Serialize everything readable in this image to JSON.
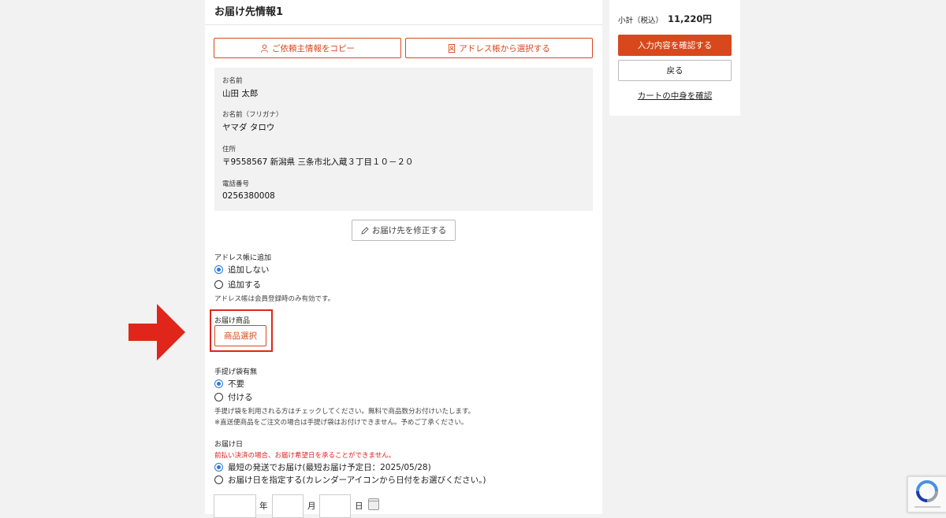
{
  "form": {
    "section_title": "お届け先情報1",
    "copy_button": "ご依頼主情報をコピー",
    "addressbook_button": "アドレス帳から選択する",
    "info": {
      "name_label": "お名前",
      "name_value": "山田 太郎",
      "kana_label": "お名前（フリガナ）",
      "kana_value": "ヤマダ タロウ",
      "address_label": "住所",
      "address_value": "〒9558567 新潟県 三条市北入蔵３丁目１０－２０",
      "phone_label": "電話番号",
      "phone_value": "0256380008"
    },
    "edit_button": "お届け先を修正する",
    "addressbook_add": {
      "label": "アドレス帳に追加",
      "options": [
        "追加しない",
        "追加する"
      ],
      "selected_index": 0,
      "note": "アドレス帳は会員登録時のみ有効です。"
    },
    "product": {
      "label": "お届け商品",
      "button": "商品選択"
    },
    "bag": {
      "label": "手提げ袋有無",
      "options": [
        "不要",
        "付ける"
      ],
      "selected_index": 0,
      "note1": "手提げ袋を利用される方はチェックしてください。無料で商品数分お付けいたします。",
      "note2": "※直送便商品をご注文の場合は手提げ袋はお付けできません。予めご了承ください。"
    },
    "delivery_date": {
      "label": "お届け日",
      "warning": "前払い決済の場合、お届け希望日を承ることができません。",
      "options": [
        "最短の発送でお届け(最短お届け予定日：2025/05/28)",
        "お届け日を指定する(カレンダーアイコンから日付をお選びください。)"
      ],
      "selected_index": 0,
      "year_unit": "年",
      "month_unit": "月",
      "day_unit": "日"
    }
  },
  "summary": {
    "subtotal_label": "小計（税込）",
    "subtotal_value": "11,220円",
    "confirm_button": "入力内容を確認する",
    "back_button": "戻る",
    "cart_link": "カートの中身を確認"
  },
  "colors": {
    "accent": "#d9481c",
    "highlight": "#e0251b",
    "radio_checked": "#2a7ad8"
  },
  "icons": {
    "copy": "person-icon",
    "addressbook": "address-book-icon",
    "edit": "pencil-icon",
    "calendar": "calendar-icon",
    "arrow": "right-arrow-icon"
  }
}
